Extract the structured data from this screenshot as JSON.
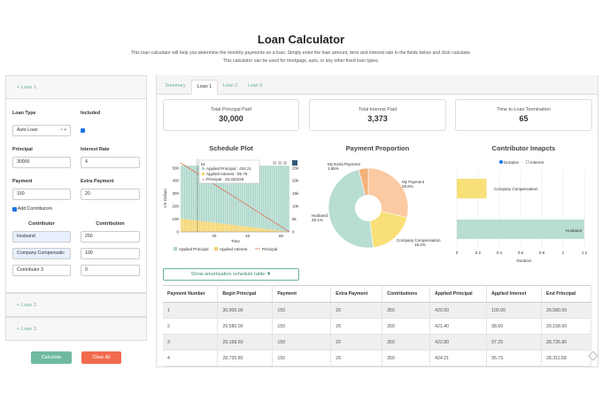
{
  "page": {
    "title": "Loan Calculator",
    "intro_line1": "This loan calculator will help you determine the monthly payments on a loan. Simply enter the loan amount, term and interest rate in the fields below and click calculate.",
    "intro_line2": "This calculator can be used for mortgage, auto, or any other fixed loan types."
  },
  "loans": {
    "loan1_label": "+ Loan 1",
    "loan2_label": "+ Loan 2",
    "loan3_label": "+ Loan 3"
  },
  "form": {
    "loan_type_label": "Loan Type",
    "loan_type_value": "Auto Loan",
    "included_label": "Included",
    "principal_label": "Principal",
    "principal_value": "30000",
    "interest_label": "Interest Rate",
    "interest_value": "4",
    "payment_label": "Payment",
    "payment_value": "150",
    "extra_payment_label": "Extra Payment",
    "extra_payment_value": "20",
    "add_contributors_label": "Add Contributors",
    "contributor_header": "Contributor",
    "contribution_header": "Contribution",
    "contributors": [
      {
        "name": "Husband",
        "amount": "250"
      },
      {
        "name": "Company Compensatic",
        "amount": "100"
      },
      {
        "name": "Contributor 3",
        "amount": "0"
      }
    ],
    "calculate_label": "Calculate",
    "clear_label": "Clear All"
  },
  "tabs": [
    "Summary",
    "Loan 1",
    "Loan 2",
    "Loan 3"
  ],
  "cards": [
    {
      "title": "Total Principal Paid",
      "value": "30,000"
    },
    {
      "title": "Total Interest Paid",
      "value": "3,373"
    },
    {
      "title": "Time to Loan Termination",
      "value": "65"
    }
  ],
  "schedule_plot": {
    "title": "Schedule Plot",
    "ylabel": "US Dollars",
    "xlabel": "Time",
    "x_ticks": [
      "20",
      "40",
      "60"
    ],
    "y_left_ticks": [
      "0",
      "100",
      "200",
      "300",
      "400",
      "500"
    ],
    "y_right_ticks": [
      "0",
      "5k",
      "10k",
      "15k",
      "20k",
      "25k"
    ],
    "legend": [
      "Applied Principal",
      "Applied Interest",
      "Principal"
    ],
    "tooltip": {
      "title": "51",
      "lines": [
        "Applied Principal : 434.21",
        "Applied Interest : 85.79",
        "Principal : 25,332226"
      ]
    },
    "colors": {
      "principal_bar": "#a8d5c8",
      "interest_bar": "#f5d36a",
      "principal_line": "#e07060"
    }
  },
  "payment_proportion": {
    "title": "Payment Proportion",
    "slices": [
      {
        "label": "Husband",
        "pct": "48.1%",
        "value": 48.1,
        "color": "#b8ddd3"
      },
      {
        "label": "Company Compensation",
        "pct": "19.2%",
        "value": 19.2,
        "color": "#f8df77"
      },
      {
        "label": "My Payment",
        "pct": "28.8%",
        "value": 28.8,
        "color": "#fbcaa2"
      },
      {
        "label": "My Extra Payment",
        "pct": "3.85%",
        "value": 3.85,
        "color": "#f2b27c"
      }
    ]
  },
  "contributor_impacts": {
    "title": "Contributor Imapcts",
    "radio_duration": "Duration",
    "radio_interest": "Interest",
    "xlabel": "Duration",
    "x_ticks": [
      "0",
      "0.2",
      "0.4",
      "0.6",
      "0.8",
      "1",
      "1.2"
    ],
    "bars": [
      {
        "label": "Company Compensation",
        "value": 0.28,
        "color": "#f8df77"
      },
      {
        "label": "Husband",
        "value": 1.2,
        "color": "#b8ddd3"
      }
    ]
  },
  "amortization": {
    "toggle_label": "Show amortization schedule table ▼",
    "headers": [
      "Payment Number",
      "Begin Principal",
      "Payment",
      "Extra Payment",
      "Contributions",
      "Applied Principal",
      "Applied Interest",
      "End Principal"
    ],
    "rows": [
      [
        "1",
        "30,000.00",
        "150",
        "20",
        "350",
        "420.00",
        "100.00",
        "29,580.00"
      ],
      [
        "2",
        "29,580.00",
        "150",
        "20",
        "350",
        "421.40",
        "98.60",
        "29,158.60"
      ],
      [
        "3",
        "29,158.60",
        "150",
        "20",
        "350",
        "422.80",
        "97.20",
        "28,735.80"
      ],
      [
        "4",
        "28,735.80",
        "150",
        "20",
        "350",
        "424.21",
        "95.79",
        "28,311.58"
      ]
    ]
  }
}
